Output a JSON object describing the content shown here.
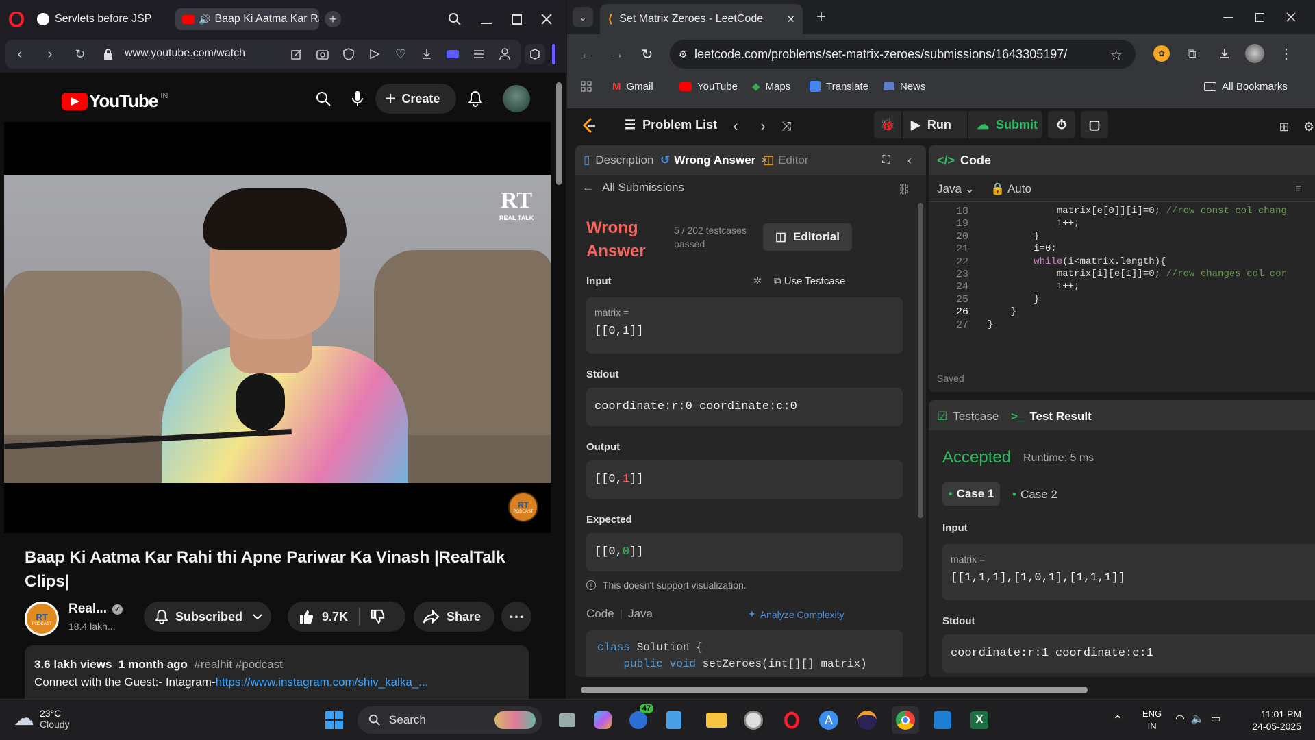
{
  "left_window": {
    "tabs": [
      {
        "title": "Servlets before JSP"
      },
      {
        "title": "Baap Ki Aatma Kar Rahi"
      }
    ],
    "address": "www.youtube.com/watch",
    "youtube": {
      "logo_text": "YouTube",
      "region": "IN",
      "create_label": "Create",
      "video_title": "Baap Ki Aatma Kar Rahi thi Apne Pariwar Ka Vinash |RealTalk Clips|",
      "channel_name": "Real...",
      "subscribers": "18.4 lakh...",
      "subscribed_label": "Subscribed",
      "likes": "9.7K",
      "share_label": "Share",
      "views": "3.6 lakh views",
      "age": "1 month ago",
      "hashtags": "#realhit #podcast",
      "desc_prefix": "Connect with the Guest:- Intagram-",
      "desc_link": "https://www.instagram.com/shiv_kalka_...",
      "watermark_logo": "RT",
      "watermark_sub": "REAL TALK",
      "avatar_text": "RT",
      "avatar_sub": "PODCAST"
    }
  },
  "right_window": {
    "tab_title": "Set Matrix Zeroes - LeetCode",
    "url": "leetcode.com/problems/set-matrix-zeroes/submissions/1643305197/",
    "bookmarks": [
      "Gmail",
      "YouTube",
      "Maps",
      "Translate",
      "News"
    ],
    "all_bookmarks": "All Bookmarks",
    "nav": {
      "problem_list": "Problem List",
      "run": "Run",
      "submit": "Submit"
    },
    "left_panel": {
      "tabs": [
        "Description",
        "Wrong Answer",
        "Editori"
      ],
      "all_submissions": "All Submissions",
      "status": "Wrong Answer",
      "status_line1": "Wrong",
      "status_line2": "Answer",
      "testcases_line1": "5 / 202 testcases",
      "testcases_line2": "passed",
      "editorial_label": "Editorial",
      "input_label": "Input",
      "use_testcase": "Use Testcase",
      "var_name": "matrix =",
      "input_value": "[[0,1]]",
      "stdout_label": "Stdout",
      "stdout_value": "coordinate:r:0 coordinate:c:0",
      "output_label": "Output",
      "output_parts": [
        "[[0,",
        "1",
        "]]"
      ],
      "expected_label": "Expected",
      "expected_parts": [
        "[[0,",
        "0",
        "]]"
      ],
      "no_vis": "This doesn't support visualization.",
      "code_label": "Code",
      "code_lang": "Java",
      "analyze": "Analyze Complexity",
      "code_preview": [
        {
          "kw": "class ",
          "rest": "Solution {"
        },
        {
          "kw": "    public void ",
          "rest": "setZeroes(int[][] matrix)"
        }
      ]
    },
    "code_panel": {
      "title": "Code",
      "lang": "Java",
      "mode": "Auto",
      "saved": "Saved",
      "lines": [
        {
          "n": "18",
          "code": "            matrix[e[0]][i]=0;",
          "comment": " //row const col chang"
        },
        {
          "n": "19",
          "code": "            i++;",
          "comment": ""
        },
        {
          "n": "20",
          "code": "        }",
          "comment": ""
        },
        {
          "n": "21",
          "code": "        i=0;",
          "comment": ""
        },
        {
          "n": "22",
          "code": "        while(i<matrix.length){",
          "comment": ""
        },
        {
          "n": "23",
          "code": "            matrix[i][e[1]]=0;",
          "comment": " //row changes col cor"
        },
        {
          "n": "24",
          "code": "            i++;",
          "comment": ""
        },
        {
          "n": "25",
          "code": "        }",
          "comment": ""
        },
        {
          "n": "26",
          "code": "    }",
          "comment": ""
        },
        {
          "n": "27",
          "code": "}",
          "comment": ""
        }
      ]
    },
    "result_panel": {
      "testcase_tab": "Testcase",
      "result_tab": "Test Result",
      "accepted": "Accepted",
      "runtime": "Runtime: 5 ms",
      "case1": "Case 1",
      "case2": "Case 2",
      "input_label": "Input",
      "var_name": "matrix =",
      "input_value": "[[1,1,1],[1,0,1],[1,1,1]]",
      "stdout_label": "Stdout",
      "stdout_value": "coordinate:r:1 coordinate:c:1"
    }
  },
  "taskbar": {
    "temp": "23°C",
    "weather": "Cloudy",
    "search": "Search",
    "badge": "47",
    "lang1": "ENG",
    "lang2": "IN",
    "time": "11:01 PM",
    "date": "24-05-2025"
  },
  "colors": {
    "wrong": "#f8615c",
    "accepted": "#2cbb5d",
    "link": "#3ea6ff",
    "lc_orange": "#ffa116"
  }
}
